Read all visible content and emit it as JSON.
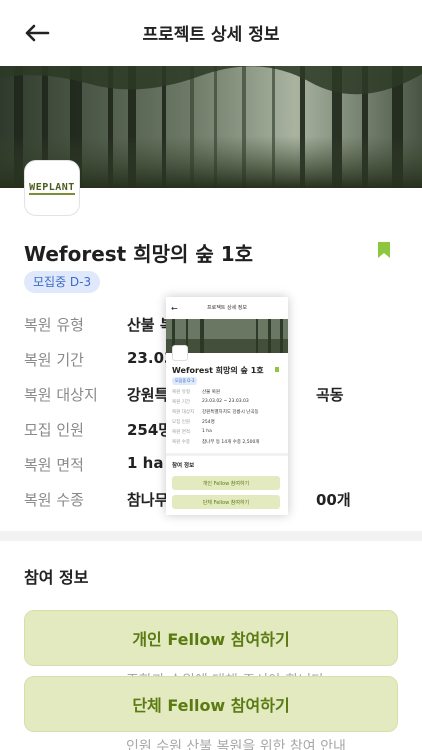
{
  "header": {
    "title": "프로젝트 상세 정보"
  },
  "logo": {
    "text": "WEPLANT"
  },
  "project": {
    "title": "Weforest 희망의 숲 1호",
    "badge": "모집중 D-3"
  },
  "info": [
    {
      "label": "복원 유형",
      "value": "산불 복"
    },
    {
      "label": "복원 기간",
      "value": "23.03"
    },
    {
      "label": "복원 대상지",
      "value": "강원특",
      "suffix": "곡동"
    },
    {
      "label": "모집 인원",
      "value": "254명"
    },
    {
      "label": "복원 면적",
      "value": "1 ha"
    },
    {
      "label": "복원 수종",
      "value": "참나무",
      "suffix": "00개"
    }
  ],
  "participation": {
    "section_title": "참여 정보",
    "individual_button": "개인  Fellow 참여하기",
    "group_button": "단체 Fellow 참여하기",
    "behind_text_1": "조합과 수원에 대해 주셔야 합니다",
    "behind_text_2": "인원 수원 산불 복원을 위한 참여 안내"
  },
  "inset": {
    "header_title": "프로젝트 상세 정보",
    "project_title": "Weforest 희망의 숲 1호",
    "badge": "모집중 D-3",
    "rows": [
      {
        "label": "복원 유형",
        "value": "산불 복원"
      },
      {
        "label": "복원 기간",
        "value": "23.03.02 ~ 23.03.03"
      },
      {
        "label": "복원 대상지",
        "value": "강원특별자치도 강릉시 난곡동"
      },
      {
        "label": "모집 인원",
        "value": "254명"
      },
      {
        "label": "복원 면적",
        "value": "1 ha"
      },
      {
        "label": "복원 수종",
        "value": "참나무 등 14개 수종 2,500개"
      }
    ],
    "section_title": "참여 정보",
    "individual_button": "개인 Fellow 참여하기",
    "group_button": "단체 Fellow 참여하기"
  },
  "colors": {
    "accent_green": "#8ec63f",
    "button_bg": "#e3eac0",
    "button_text": "#5a7a12",
    "badge_bg": "#dfe9fb",
    "badge_text": "#3a6bc9"
  }
}
